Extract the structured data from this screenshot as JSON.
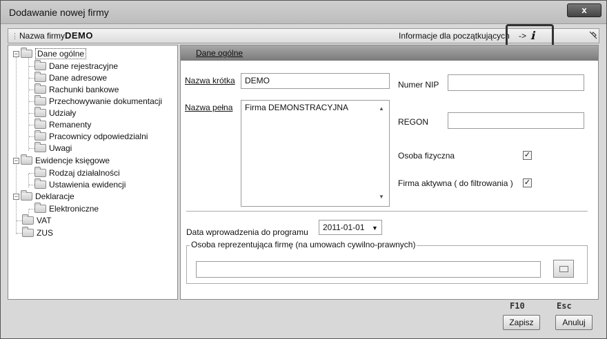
{
  "window": {
    "title": "Dodawanie nowej firmy",
    "close_label": "x"
  },
  "toolbar": {
    "company_label": "Nazwa firmy",
    "company_value": "DEMO",
    "info_text": "Informacje dla początkujących",
    "info_arrow": "->",
    "info_icon": "ℹ",
    "pin_icon": "pin-icon"
  },
  "tree": {
    "items": [
      {
        "label": "Dane ogólne"
      },
      {
        "label": "Dane rejestracyjne"
      },
      {
        "label": "Dane adresowe"
      },
      {
        "label": "Rachunki bankowe"
      },
      {
        "label": "Przechowywanie dokumentacji"
      },
      {
        "label": "Udziały"
      },
      {
        "label": "Remanenty"
      },
      {
        "label": "Pracownicy odpowiedzialni"
      },
      {
        "label": "Uwagi"
      },
      {
        "label": "Ewidencje księgowe"
      },
      {
        "label": "Rodzaj działalności"
      },
      {
        "label": "Ustawienia ewidencji"
      },
      {
        "label": "Deklaracje"
      },
      {
        "label": "Elektroniczne"
      },
      {
        "label": "VAT"
      },
      {
        "label": "ZUS"
      }
    ],
    "expander_minus": "−"
  },
  "content": {
    "header": "Dane ogólne",
    "short_name_label": "Nazwa krótka",
    "short_name_value": "DEMO",
    "full_name_label": "Nazwa pełna",
    "full_name_value": "Firma DEMONSTRACYJNA",
    "nip_label": "Numer NIP",
    "nip_value": "",
    "regon_label": "REGON",
    "regon_value": "",
    "natural_person_label": "Osoba fizyczna",
    "natural_person_checked": "✓",
    "active_company_label": "Firma aktywna ( do filtrowania )",
    "active_company_checked": "✓",
    "date_label": "Data wprowadzenia do programu",
    "date_value": "2011-01-01",
    "representative_legend": "Osoba reprezentująca firmę (na umowach cywilno-prawnych)",
    "representative_value": ""
  },
  "footer": {
    "save_key": "F10",
    "save_label": "Zapisz",
    "cancel_key": "Esc",
    "cancel_label": "Anuluj"
  }
}
